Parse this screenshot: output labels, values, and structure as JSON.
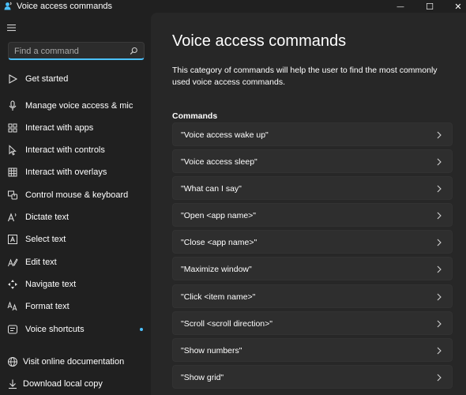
{
  "window": {
    "title": "Voice access commands",
    "min_glyph": "—",
    "max_glyph": "☐",
    "close_glyph": "✕"
  },
  "sidebar": {
    "search": {
      "placeholder": "Find a command",
      "value": ""
    },
    "items": [
      {
        "label": "Get started",
        "icon": "play-icon"
      },
      {
        "label": "Manage voice access & mic",
        "icon": "microphone-icon"
      },
      {
        "label": "Interact with apps",
        "icon": "apps-icon"
      },
      {
        "label": "Interact with controls",
        "icon": "cursor-icon"
      },
      {
        "label": "Interact with overlays",
        "icon": "grid-icon"
      },
      {
        "label": "Control mouse & keyboard",
        "icon": "keyboard-icon"
      },
      {
        "label": "Dictate text",
        "icon": "dictate-icon"
      },
      {
        "label": "Select text",
        "icon": "select-text-icon"
      },
      {
        "label": "Edit text",
        "icon": "edit-text-icon"
      },
      {
        "label": "Navigate text",
        "icon": "navigate-icon"
      },
      {
        "label": "Format text",
        "icon": "format-text-icon"
      },
      {
        "label": "Voice shortcuts",
        "icon": "shortcuts-icon",
        "badge": true
      }
    ],
    "footer": [
      {
        "label": "Visit online documentation",
        "icon": "globe-icon"
      },
      {
        "label": "Download local copy",
        "icon": "download-icon"
      }
    ]
  },
  "main": {
    "title": "Voice access commands",
    "description": "This category of commands will help the user to find the most commonly used voice access commands.",
    "section_title": "Commands",
    "commands": [
      "\"Voice access wake up\"",
      "\"Voice access sleep\"",
      "\"What can I say\"",
      "\"Open <app name>\"",
      "\"Close <app name>\"",
      "\"Maximize window\"",
      "\"Click <item name>\"",
      "\"Scroll <scroll direction>\"",
      "\"Show numbers\"",
      "\"Show grid\""
    ]
  },
  "colors": {
    "accent": "#4cc2ff",
    "background": "#202020",
    "content": "#272727",
    "card": "#2e2e2e"
  }
}
